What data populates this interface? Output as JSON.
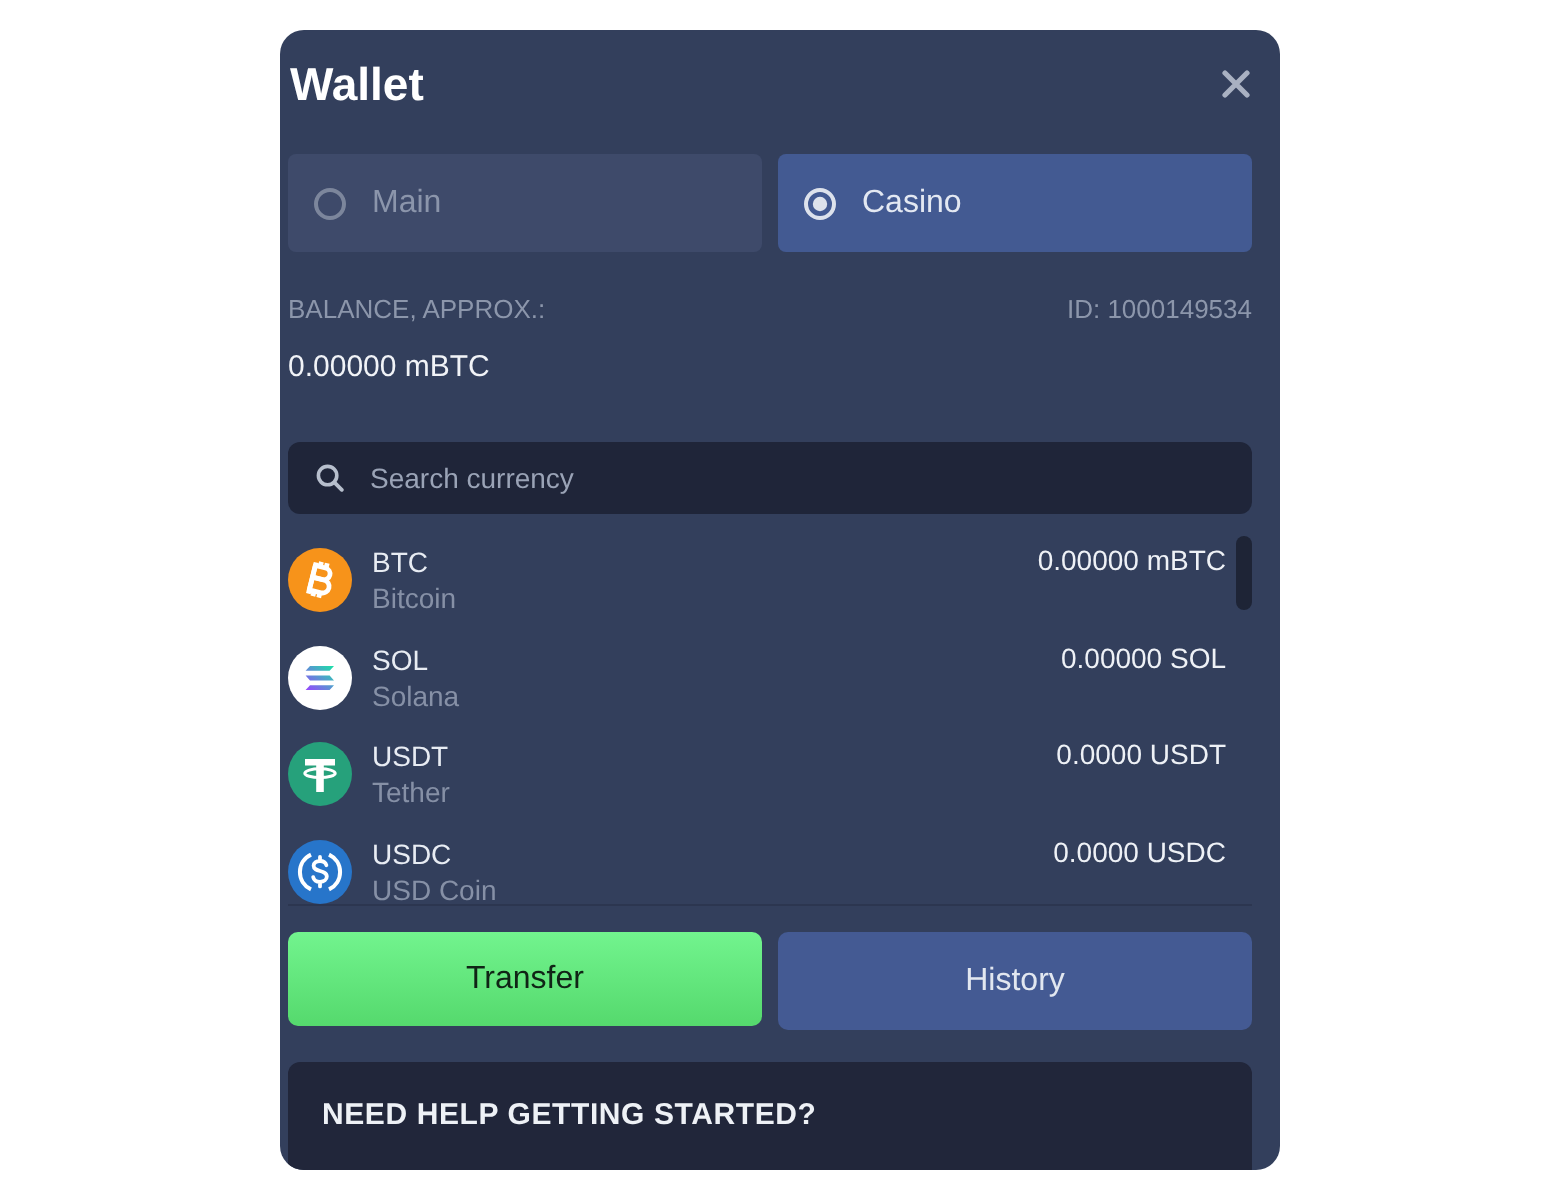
{
  "window": {
    "title": "Wallet"
  },
  "tabs": [
    {
      "label": "Main",
      "selected": false
    },
    {
      "label": "Casino",
      "selected": true
    }
  ],
  "balance": {
    "label": "BALANCE, APPROX.:",
    "id": "ID: 1000149534",
    "value": "0.00000 mBTC"
  },
  "search": {
    "placeholder": "Search currency"
  },
  "currencies": [
    {
      "kind": "btc",
      "code": "BTC",
      "name": "Bitcoin",
      "amount": "0.00000 mBTC"
    },
    {
      "kind": "sol",
      "code": "SOL",
      "name": "Solana",
      "amount": "0.00000 SOL"
    },
    {
      "kind": "usdt",
      "code": "USDT",
      "name": "Tether",
      "amount": "0.0000 USDT"
    },
    {
      "kind": "usdc",
      "code": "USDC",
      "name": "USD Coin",
      "amount": "0.0000 USDC"
    }
  ],
  "buttons": [
    {
      "kind": "primary",
      "label": "Transfer"
    },
    {
      "kind": "secondary",
      "label": "History"
    }
  ],
  "help": {
    "title": "NEED HELP GETTING STARTED?"
  }
}
